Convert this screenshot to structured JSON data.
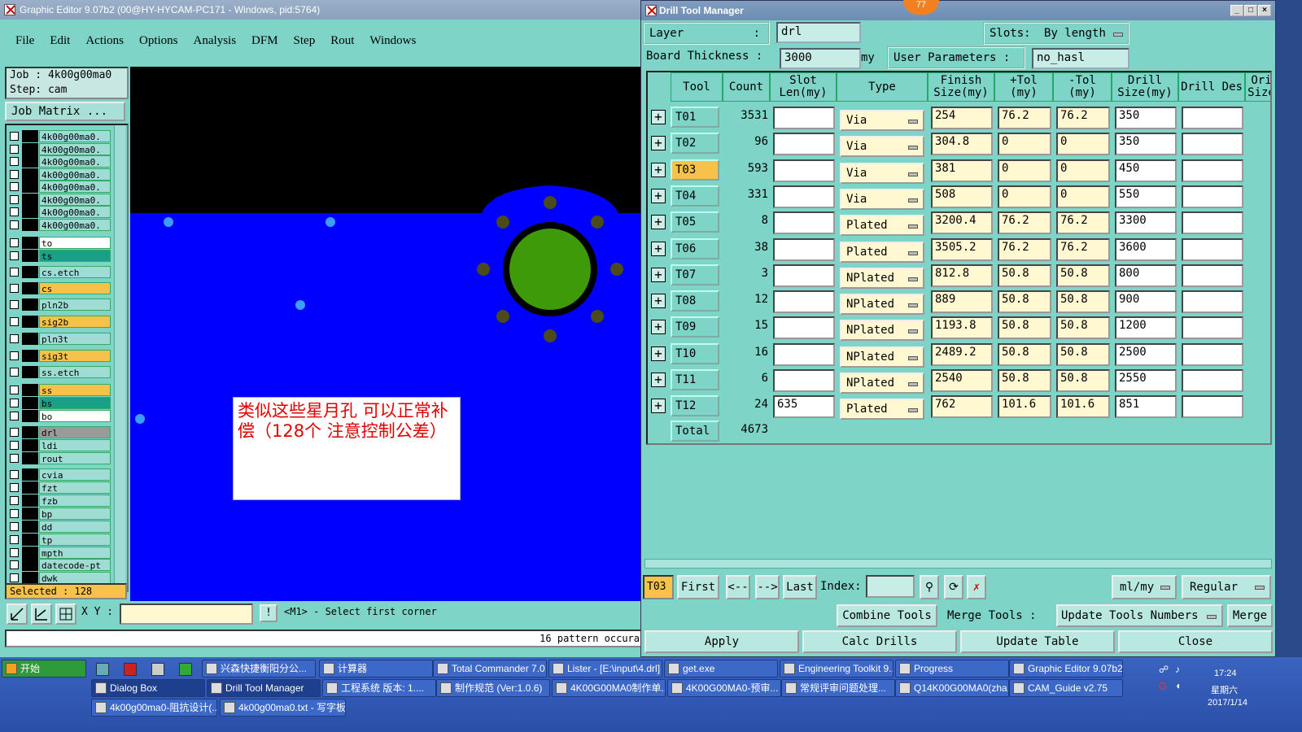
{
  "ge": {
    "title": "Graphic Editor 9.07b2 (00@HY-HYCAM-PC171 - Windows, pid:5764)",
    "menu": [
      "File",
      "Edit",
      "Actions",
      "Options",
      "Analysis",
      "DFM",
      "Step",
      "Rout",
      "Windows"
    ],
    "job_label": "Job  :  4k00g00ma0",
    "step_label": "Step:  cam",
    "job_matrix": "Job Matrix ...",
    "layers": [
      {
        "name": "4k00g00ma0.",
        "color": "#9edcd4"
      },
      {
        "name": "4k00g00ma0.",
        "color": "#9edcd4"
      },
      {
        "name": "4k00g00ma0.",
        "color": "#9edcd4"
      },
      {
        "name": "4k00g00ma0.",
        "color": "#9edcd4"
      },
      {
        "name": "4k00g00ma0.",
        "color": "#9edcd4"
      },
      {
        "name": "4k00g00ma0.",
        "color": "#9edcd4"
      },
      {
        "name": "4k00g00ma0.",
        "color": "#9edcd4"
      },
      {
        "name": "4k00g00ma0.",
        "color": "#9edcd4"
      },
      {
        "name": "to",
        "color": "#ffffff"
      },
      {
        "name": "ts",
        "color": "#1aa088"
      },
      {
        "name": "cs.etch",
        "color": "#9edcd4"
      },
      {
        "name": "cs",
        "color": "#f6c24a"
      },
      {
        "name": "pln2b",
        "color": "#9edcd4"
      },
      {
        "name": "sig2b",
        "color": "#f6c24a"
      },
      {
        "name": "pln3t",
        "color": "#9edcd4"
      },
      {
        "name": "sig3t",
        "color": "#f6c24a"
      },
      {
        "name": "ss.etch",
        "color": "#9edcd4"
      },
      {
        "name": "ss",
        "color": "#f6c24a"
      },
      {
        "name": "bs",
        "color": "#1aa088"
      },
      {
        "name": "bo",
        "color": "#ffffff"
      },
      {
        "name": "drl",
        "color": "#9a9a9a"
      },
      {
        "name": "ldi",
        "color": "#9edcd4"
      },
      {
        "name": "rout",
        "color": "#9edcd4"
      },
      {
        "name": "cvia",
        "color": "#9edcd4"
      },
      {
        "name": "fzt",
        "color": "#9edcd4"
      },
      {
        "name": "fzb",
        "color": "#9edcd4"
      },
      {
        "name": "bp",
        "color": "#9edcd4"
      },
      {
        "name": "dd",
        "color": "#9edcd4"
      },
      {
        "name": "tp",
        "color": "#9edcd4"
      },
      {
        "name": "mpth",
        "color": "#9edcd4"
      },
      {
        "name": "datecode-pt",
        "color": "#9edcd4"
      },
      {
        "name": "dwk",
        "color": "#9edcd4"
      }
    ],
    "selected": "Selected : 128",
    "xy_label": "X Y :",
    "prompt": "<M1> - Select first corner",
    "status": "16 pattern occura",
    "note": "类似这些星月孔  可以正常补偿（128个  注意控制公差）"
  },
  "dtm": {
    "title": "Drill Tool Manager",
    "layer_label": "Layer",
    "layer_value": "drl",
    "slots_label": "Slots:",
    "slots_value": "By length",
    "board_thickness_label": "Board Thickness :",
    "board_thickness_value": "3000",
    "board_thickness_unit": "my",
    "user_params_label": "User Parameters :",
    "user_params_value": "no_hasl",
    "headers": [
      "Tool",
      "Count",
      "Slot Len(my)",
      "Type",
      "Finish Size(my)",
      "+Tol (my)",
      "-Tol (my)",
      "Drill Size(my)",
      "Drill Des",
      "Ori Size"
    ],
    "rows": [
      {
        "tool": "T01",
        "count": "3531",
        "slot": "",
        "type": "Via",
        "finish": "254",
        "ptol": "76.2",
        "mtol": "76.2",
        "drill": "350"
      },
      {
        "tool": "T02",
        "count": "96",
        "slot": "",
        "type": "Via",
        "finish": "304.8",
        "ptol": "0",
        "mtol": "0",
        "drill": "350"
      },
      {
        "tool": "T03",
        "count": "593",
        "slot": "",
        "type": "Via",
        "finish": "381",
        "ptol": "0",
        "mtol": "0",
        "drill": "450"
      },
      {
        "tool": "T04",
        "count": "331",
        "slot": "",
        "type": "Via",
        "finish": "508",
        "ptol": "0",
        "mtol": "0",
        "drill": "550"
      },
      {
        "tool": "T05",
        "count": "8",
        "slot": "",
        "type": "Plated",
        "finish": "3200.4",
        "ptol": "76.2",
        "mtol": "76.2",
        "drill": "3300"
      },
      {
        "tool": "T06",
        "count": "38",
        "slot": "",
        "type": "Plated",
        "finish": "3505.2",
        "ptol": "76.2",
        "mtol": "76.2",
        "drill": "3600"
      },
      {
        "tool": "T07",
        "count": "3",
        "slot": "",
        "type": "NPlated",
        "finish": "812.8",
        "ptol": "50.8",
        "mtol": "50.8",
        "drill": "800"
      },
      {
        "tool": "T08",
        "count": "12",
        "slot": "",
        "type": "NPlated",
        "finish": "889",
        "ptol": "50.8",
        "mtol": "50.8",
        "drill": "900"
      },
      {
        "tool": "T09",
        "count": "15",
        "slot": "",
        "type": "NPlated",
        "finish": "1193.8",
        "ptol": "50.8",
        "mtol": "50.8",
        "drill": "1200"
      },
      {
        "tool": "T10",
        "count": "16",
        "slot": "",
        "type": "NPlated",
        "finish": "2489.2",
        "ptol": "50.8",
        "mtol": "50.8",
        "drill": "2500"
      },
      {
        "tool": "T11",
        "count": "6",
        "slot": "",
        "type": "NPlated",
        "finish": "2540",
        "ptol": "50.8",
        "mtol": "50.8",
        "drill": "2550"
      },
      {
        "tool": "T12",
        "count": "24",
        "slot": "635",
        "type": "Plated",
        "finish": "762",
        "ptol": "101.6",
        "mtol": "101.6",
        "drill": "851"
      }
    ],
    "total_label": "Total",
    "total_value": "4673",
    "current_tool": "T03",
    "nav": {
      "first": "First",
      "prev": "<--",
      "next": "-->",
      "last": "Last",
      "index": "Index:"
    },
    "units": "ml/my",
    "mode": "Regular",
    "combine": "Combine Tools",
    "merge_tools": "Merge Tools :",
    "update_numbers": "Update Tools Numbers",
    "merge": "Merge",
    "apply": "Apply",
    "calc": "Calc Drills",
    "update_table": "Update Table",
    "close": "Close"
  },
  "badge": "77",
  "taskbar": {
    "start": "开始",
    "row1": [
      "兴森快捷衡阳分公...",
      "计算器",
      "Total Commander 7.0...",
      "Lister - [E:\\input\\4.drl]",
      "get.exe",
      "Engineering Toolkit 9....",
      "Progress",
      "Graphic Editor 9.07b2..."
    ],
    "row2": [
      "Dialog Box",
      "Drill Tool Manager",
      "工程系统  版本: 1....",
      "制作规范 (Ver:1.0.6)",
      "4K00G00MA0制作单...",
      "4K00G00MA0-预审...",
      "常规评审问题处理...",
      "Q14K00G00MA0(zha...",
      "CAM_Guide v2.75"
    ],
    "row3": [
      "4k00g00ma0-阻抗设计(...",
      "4k00g00ma0.txt - 写字板"
    ],
    "time": "17:24",
    "weekday": "星期六",
    "date": "2017/1/14"
  }
}
